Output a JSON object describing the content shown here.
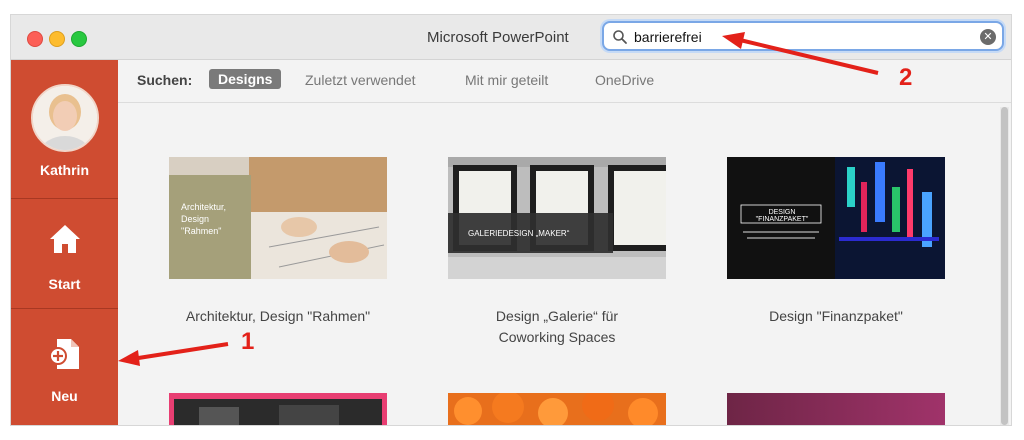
{
  "window": {
    "app_title": "Microsoft PowerPoint"
  },
  "search": {
    "value": "barrierefrei"
  },
  "sidebar": {
    "user_name": "Kathrin",
    "items": [
      {
        "label": "Start",
        "icon": "home-icon"
      },
      {
        "label": "Neu",
        "icon": "new-document-icon"
      }
    ]
  },
  "filter": {
    "label": "Suchen:",
    "tabs": [
      {
        "label": "Designs",
        "active": true
      },
      {
        "label": "Zuletzt verwendet",
        "active": false
      },
      {
        "label": "Mit mir geteilt",
        "active": false
      },
      {
        "label": "OneDrive",
        "active": false
      }
    ]
  },
  "templates": [
    {
      "caption": "Architektur, Design \"Rahmen\"",
      "thumb_text": "Architektur, Design \"Rahmen\""
    },
    {
      "caption_line1": "Design „Galerie“ für",
      "caption_line2": "Coworking Spaces",
      "thumb_text": "GALERIEDESIGN „MAKER“"
    },
    {
      "caption": "Design \"Finanzpaket\"",
      "thumb_text": "DESIGN \"FINANZPAKET\""
    }
  ],
  "annotations": {
    "one": "1",
    "two": "2"
  },
  "colors": {
    "sidebar": "#cf4c31",
    "annotation": "#e32119",
    "active_tab": "#7a7a7a"
  }
}
